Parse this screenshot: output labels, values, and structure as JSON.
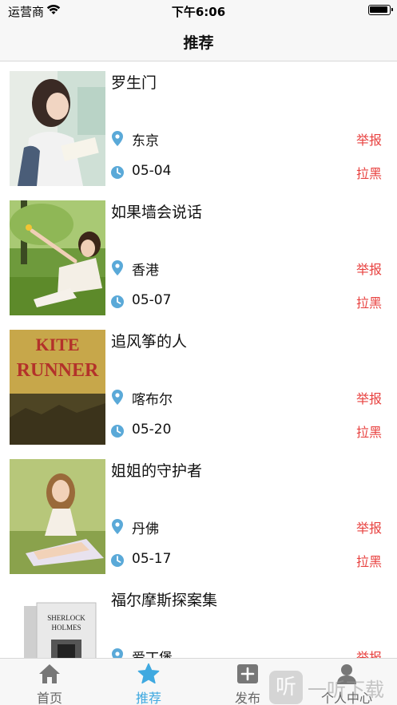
{
  "status_bar": {
    "carrier": "运营商",
    "time": "下午6:06"
  },
  "nav": {
    "title": "推荐"
  },
  "items": [
    {
      "title": "罗生门",
      "location": "东京",
      "date": "05-04",
      "report": "举报",
      "block": "拉黑"
    },
    {
      "title": "如果墙会说话",
      "location": "香港",
      "date": "05-07",
      "report": "举报",
      "block": "拉黑"
    },
    {
      "title": "追风筝的人",
      "location": "喀布尔",
      "date": "05-20",
      "report": "举报",
      "block": "拉黑"
    },
    {
      "title": "姐姐的守护者",
      "location": "丹佛",
      "date": "05-17",
      "report": "举报",
      "block": "拉黑"
    },
    {
      "title": "福尔摩斯探案集",
      "location": "爱丁堡",
      "date": "",
      "report": "举报",
      "block": ""
    }
  ],
  "covers": {
    "kite_runner": {
      "line1": "KITE",
      "line2": "RUNNER"
    },
    "sherlock": {
      "line1": "SHERLOCK",
      "line2": "HOLMES"
    }
  },
  "tabs": [
    {
      "label": "首页",
      "icon": "home-icon"
    },
    {
      "label": "推荐",
      "icon": "star-icon",
      "active": true
    },
    {
      "label": "发布",
      "icon": "plus-icon"
    },
    {
      "label": "个人中心",
      "icon": "person-icon"
    }
  ],
  "watermark": {
    "glyph": "听",
    "text": "一听下载"
  },
  "colors": {
    "accent": "#3fa9e0",
    "danger": "#e8413f",
    "icon_blue": "#5aa9d8",
    "bar_bg": "#f7f7f7"
  }
}
